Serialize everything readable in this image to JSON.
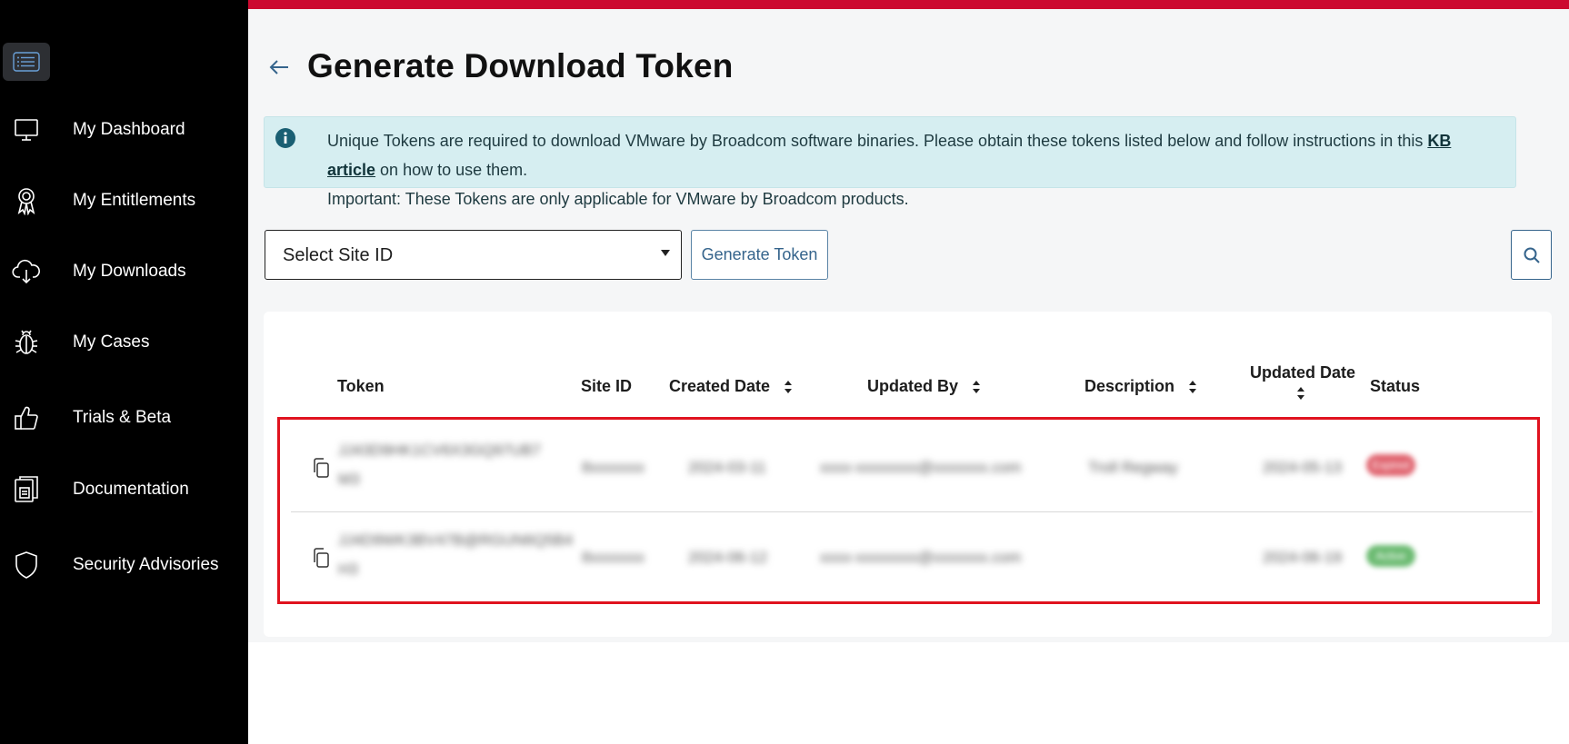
{
  "sidebar": {
    "items": [
      {
        "label": "My Dashboard",
        "icon": "monitor-icon"
      },
      {
        "label": "My Entitlements",
        "icon": "award-ribbon-icon"
      },
      {
        "label": "My Downloads",
        "icon": "cloud-download-icon"
      },
      {
        "label": "My Cases",
        "icon": "bug-icon"
      },
      {
        "label": "Trials & Beta",
        "icon": "thumbs-up-icon"
      },
      {
        "label": "Documentation",
        "icon": "document-icon"
      },
      {
        "label": "Security Advisories",
        "icon": "shield-icon"
      }
    ]
  },
  "header": {
    "title": "Generate Download Token"
  },
  "banner": {
    "text_before_link": "Unique Tokens are required to download VMware by Broadcom software binaries. Please obtain these tokens listed below and follow instructions in this ",
    "link_text": "KB article",
    "text_after_link": " on how to use them.",
    "line2": "Important: These Tokens are only applicable for VMware by Broadcom products."
  },
  "controls": {
    "site_select_value": "Select Site ID",
    "generate_button_label": "Generate Token"
  },
  "table": {
    "headers": {
      "token": "Token",
      "site_id": "Site ID",
      "created_date": "Created Date",
      "updated_by": "Updated By",
      "description": "Description",
      "updated_date": "Updated Date",
      "status": "Status"
    },
    "rows": [
      {
        "token_line1": "JJ43D9HK1CV6X3GQ97UB7",
        "token_line2": "M3",
        "site_id": "8xxxxxxx",
        "created_date": "2024-03-11",
        "updated_by": "xxxx-xxxxxxxx@xxxxxxx.com",
        "description": "Troll Regway",
        "updated_date": "2024-05-13",
        "status": "Expired",
        "status_color": "#e0646f"
      },
      {
        "token_line1": "JJ4D9WK3BV47B@RGUN6Q5B4",
        "token_line2": "H3",
        "site_id": "8xxxxxxx",
        "created_date": "2024-06-12",
        "updated_by": "xxxx-xxxxxxxx@xxxxxxx.com",
        "description": "",
        "updated_date": "2024-06-19",
        "status": "Active",
        "status_color": "#6cbb72"
      }
    ]
  },
  "colors": {
    "accent_bar": "#cc092f",
    "highlight": "#e0131f",
    "banner_bg": "#d6eef1",
    "link_blue": "#35648c"
  }
}
